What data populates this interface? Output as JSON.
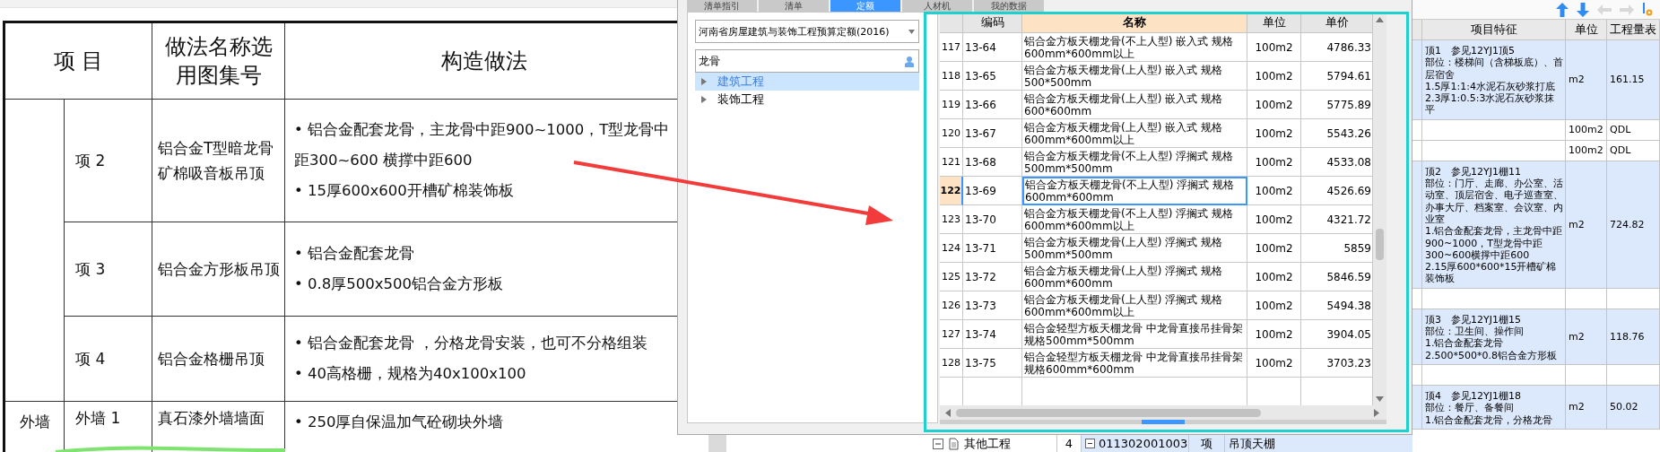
{
  "document": {
    "header": {
      "item": "项 目",
      "method_name": "做法名称选用图集号",
      "construction": "构造做法"
    },
    "groups": [
      {
        "rows": [
          {
            "item": "项 2",
            "method_name": "铝合金T型暗龙骨矿棉吸音板吊顶",
            "construction": [
              "• 铝合金配套龙骨，主龙骨中距900~1000，T型龙骨中距300~600  横撑中距600",
              "• 15厚600x600开槽矿棉装饰板"
            ]
          },
          {
            "item": "项 3",
            "method_name": "铝合金方形板吊顶",
            "construction": [
              "• 铝合金配套龙骨",
              "• 0.8厚500x500铝合金方形板"
            ]
          },
          {
            "item": "项 4",
            "method_name": "铝合金格栅吊顶",
            "construction": [
              "• 铝合金配套龙骨 ，分格龙骨安装，也可不分格组装",
              "• 40高格栅，规格为40x100x100"
            ]
          }
        ]
      },
      {
        "category": "外墙",
        "rows": [
          {
            "item": "外墙 1",
            "method_name": "真石漆外墙墙面",
            "construction": [
              "• 250厚自保温加气砼砌块外墙"
            ]
          }
        ]
      }
    ]
  },
  "dialog": {
    "tabs": [
      {
        "label": "清单指引",
        "selected": false
      },
      {
        "label": "清单",
        "selected": false
      },
      {
        "label": "定额",
        "selected": true
      },
      {
        "label": "人材机",
        "selected": false
      },
      {
        "label": "我的数据",
        "selected": false
      }
    ],
    "library": "河南省房屋建筑与装饰工程预算定额(2016)",
    "search": {
      "value": "龙骨"
    },
    "tree": [
      {
        "label": "建筑工程",
        "selected": true,
        "expanded": false
      },
      {
        "label": "装饰工程",
        "selected": false,
        "expanded": false
      }
    ],
    "quota_table": {
      "columns": [
        {
          "label": "编码",
          "selected": false
        },
        {
          "label": "名称",
          "selected": true
        },
        {
          "label": "单位",
          "selected": false
        },
        {
          "label": "单价",
          "selected": false
        }
      ],
      "rows": [
        {
          "index": "117",
          "code": "13-64",
          "name": "铝合金方板天棚龙骨(不上人型) 嵌入式 规格600mm*600mm以上",
          "unit": "100m2",
          "price": "4786.33",
          "selected": false
        },
        {
          "index": "118",
          "code": "13-65",
          "name": "铝合金方板天棚龙骨(上人型) 嵌入式 规格500*500mm",
          "unit": "100m2",
          "price": "5794.61",
          "selected": false
        },
        {
          "index": "119",
          "code": "13-66",
          "name": "铝合金方板天棚龙骨(上人型) 嵌入式 规格600*600mm",
          "unit": "100m2",
          "price": "5775.89",
          "selected": false
        },
        {
          "index": "120",
          "code": "13-67",
          "name": "铝合金方板天棚龙骨(上人型) 嵌入式 规格600mm*600mm以上",
          "unit": "100m2",
          "price": "5543.26",
          "selected": false
        },
        {
          "index": "121",
          "code": "13-68",
          "name": "铝合金方板天棚龙骨(不上人型) 浮搁式 规格500mm*500mm",
          "unit": "100m2",
          "price": "4533.08",
          "selected": false
        },
        {
          "index": "122",
          "code": "13-69",
          "name": "铝合金方板天棚龙骨(不上人型) 浮搁式 规格600mm*600mm",
          "unit": "100m2",
          "price": "4526.69",
          "selected": true
        },
        {
          "index": "123",
          "code": "13-70",
          "name": "铝合金方板天棚龙骨(不上人型) 浮搁式 规格600mm*600mm以上",
          "unit": "100m2",
          "price": "4321.72",
          "selected": false
        },
        {
          "index": "124",
          "code": "13-71",
          "name": "铝合金方板天棚龙骨(上人型) 浮搁式 规格500mm*500mm",
          "unit": "100m2",
          "price": "5859",
          "selected": false
        },
        {
          "index": "125",
          "code": "13-72",
          "name": "铝合金方板天棚龙骨(上人型) 浮搁式 规格600mm*600mm",
          "unit": "100m2",
          "price": "5846.59",
          "selected": false
        },
        {
          "index": "126",
          "code": "13-73",
          "name": "铝合金方板天棚龙骨(上人型) 浮搁式 规格600mm*600mm以上",
          "unit": "100m2",
          "price": "5494.38",
          "selected": false
        },
        {
          "index": "127",
          "code": "13-74",
          "name": "铝合金轻型方板天棚龙骨 中龙骨直接吊挂骨架规格500mm*500mm",
          "unit": "100m2",
          "price": "3904.05",
          "selected": false
        },
        {
          "index": "128",
          "code": "13-75",
          "name": "铝合金轻型方板天棚龙骨 中龙骨直接吊挂骨架规格600mm*600mm",
          "unit": "100m2",
          "price": "3703.23",
          "selected": false
        }
      ]
    }
  },
  "bill_table": {
    "columns": [
      "项目特征",
      "单位",
      "工程量表"
    ],
    "rows": [
      {
        "kind": "item",
        "features": [
          "顶1　参见12YJ1顶5",
          "部位：楼梯间（含梯板底）、首层宿舍",
          "1.5厚1:1:4水泥石灰砂浆打底",
          "2.3厚1:0.5:3水泥石灰砂浆抹平"
        ],
        "unit": "m2",
        "quantity": "161.15"
      },
      {
        "kind": "quota",
        "unit": "100m2",
        "quantity": "QDL"
      },
      {
        "kind": "quota",
        "unit": "100m2",
        "quantity": "QDL"
      },
      {
        "kind": "item",
        "features": [
          "顶2　参见12YJ1棚11",
          "部位：门厅、走廊、办公室、活动室、顶层宿舍、电子巡查室、办事大厅、档案室、会议室、内业室",
          "1.铝合金配套龙骨，主龙骨中距900~1000，T型龙骨中距300~600横撑中距600",
          "2.15厚600*600*15开槽矿棉装饰板"
        ],
        "unit": "m2",
        "quantity": "724.82"
      },
      {
        "kind": "quota"
      },
      {
        "kind": "item",
        "features": [
          "顶3　参见12YJ1棚15",
          "部位：卫生间、操作间",
          "1.铝合金配套龙骨",
          "2.500*500*0.8铝合金方形板"
        ],
        "unit": "m2",
        "quantity": "118.76"
      },
      {
        "kind": "quota"
      },
      {
        "kind": "item",
        "features": [
          "顶4　参见12YJ1棚18",
          "部位：餐厅、备餐间",
          "1.铝合金配套龙骨，分格龙骨"
        ],
        "unit": "m2",
        "quantity": "50.02"
      }
    ]
  },
  "bottom_row": {
    "tree_label": "其他工程",
    "count": "4",
    "code": "011302001003",
    "type": "项",
    "name": "吊顶天棚"
  }
}
